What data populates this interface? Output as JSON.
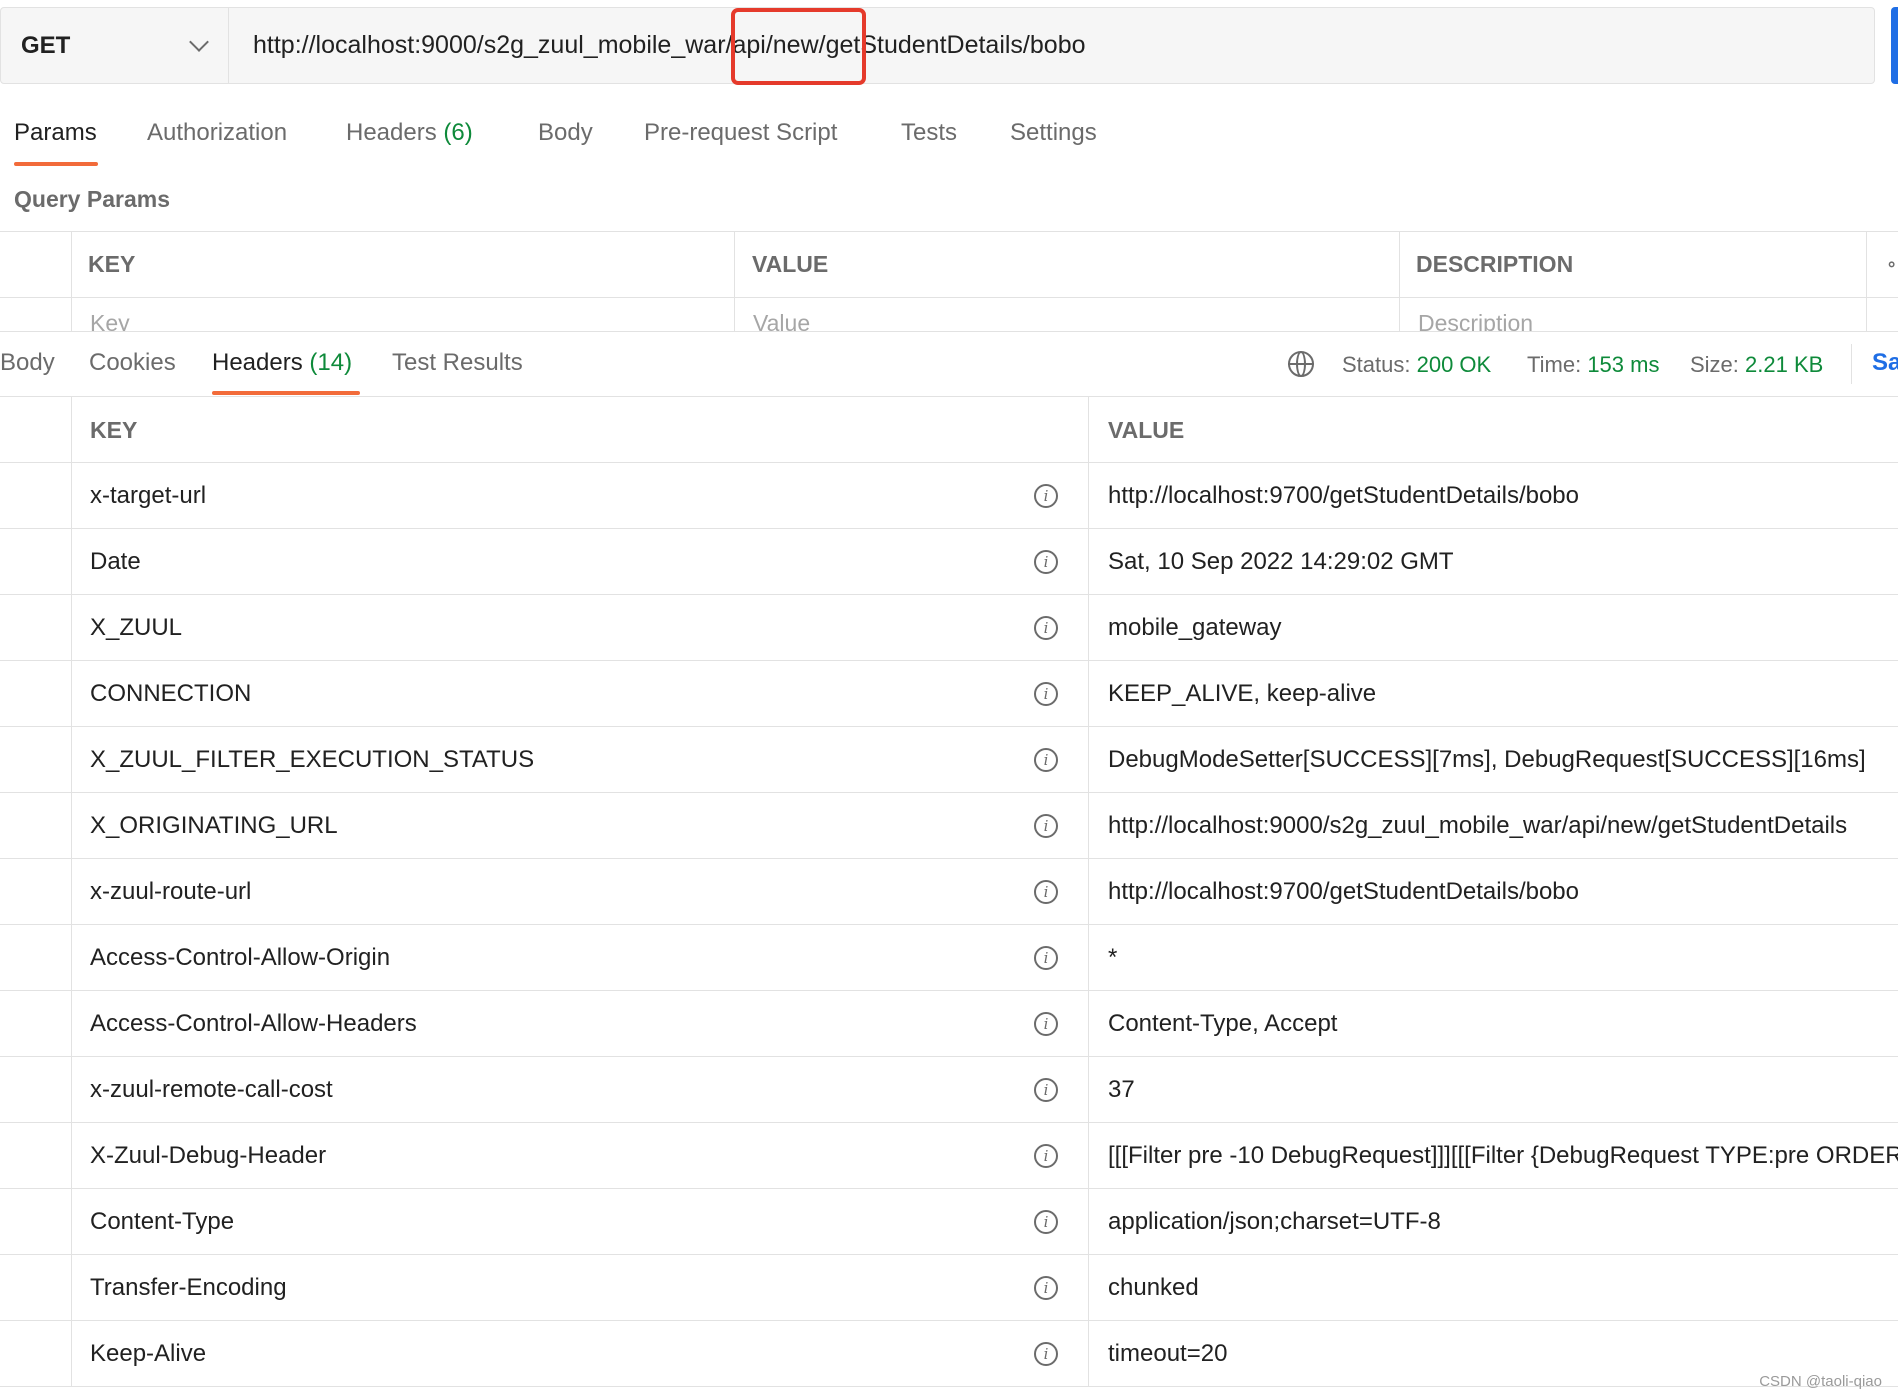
{
  "request": {
    "method": "GET",
    "url": "http://localhost:9000/s2g_zuul_mobile_war/api/new/getStudentDetails/bobo"
  },
  "request_tabs": [
    {
      "label": "Params",
      "count": ""
    },
    {
      "label": "Authorization",
      "count": ""
    },
    {
      "label": "Headers",
      "count": "(6)"
    },
    {
      "label": "Body",
      "count": ""
    },
    {
      "label": "Pre-request Script",
      "count": ""
    },
    {
      "label": "Tests",
      "count": ""
    },
    {
      "label": "Settings",
      "count": ""
    }
  ],
  "query_params": {
    "title": "Query Params",
    "columns": [
      "KEY",
      "VALUE",
      "DESCRIPTION"
    ],
    "placeholders": [
      "Key",
      "Value",
      "Description"
    ]
  },
  "response_tabs": [
    {
      "label": "Body",
      "count": ""
    },
    {
      "label": "Cookies",
      "count": ""
    },
    {
      "label": "Headers",
      "count": "(14)"
    },
    {
      "label": "Test Results",
      "count": ""
    }
  ],
  "status": {
    "status_label": "Status:",
    "status_value": "200 OK",
    "time_label": "Time:",
    "time_value": "153 ms",
    "size_label": "Size:",
    "size_value": "2.21 KB",
    "save_label": "Sa"
  },
  "headers_table": {
    "columns": [
      "KEY",
      "VALUE"
    ],
    "rows": [
      {
        "key": "x-target-url",
        "value": "http://localhost:9700/getStudentDetails/bobo"
      },
      {
        "key": "Date",
        "value": "Sat, 10 Sep 2022 14:29:02 GMT"
      },
      {
        "key": "X_ZUUL",
        "value": "mobile_gateway"
      },
      {
        "key": "CONNECTION",
        "value": "KEEP_ALIVE, keep-alive"
      },
      {
        "key": "X_ZUUL_FILTER_EXECUTION_STATUS",
        "value": "DebugModeSetter[SUCCESS][7ms], DebugRequest[SUCCESS][16ms]"
      },
      {
        "key": "X_ORIGINATING_URL",
        "value": "http://localhost:9000/s2g_zuul_mobile_war/api/new/getStudentDetails"
      },
      {
        "key": "x-zuul-route-url",
        "value": "http://localhost:9700/getStudentDetails/bobo"
      },
      {
        "key": "Access-Control-Allow-Origin",
        "value": "*"
      },
      {
        "key": "Access-Control-Allow-Headers",
        "value": "Content-Type, Accept"
      },
      {
        "key": "x-zuul-remote-call-cost",
        "value": "37"
      },
      {
        "key": "X-Zuul-Debug-Header",
        "value": "[[[Filter pre -10 DebugRequest]]][[[Filter {DebugRequest TYPE:pre ORDER"
      },
      {
        "key": "Content-Type",
        "value": "application/json;charset=UTF-8"
      },
      {
        "key": "Transfer-Encoding",
        "value": "chunked"
      },
      {
        "key": "Keep-Alive",
        "value": "timeout=20"
      }
    ]
  },
  "watermark": "CSDN @taoli-qiao",
  "colors": {
    "accent": "#f26b3a",
    "success": "#0e8a3a",
    "brand": "#1f6ee5",
    "highlight": "#e53a2b"
  }
}
